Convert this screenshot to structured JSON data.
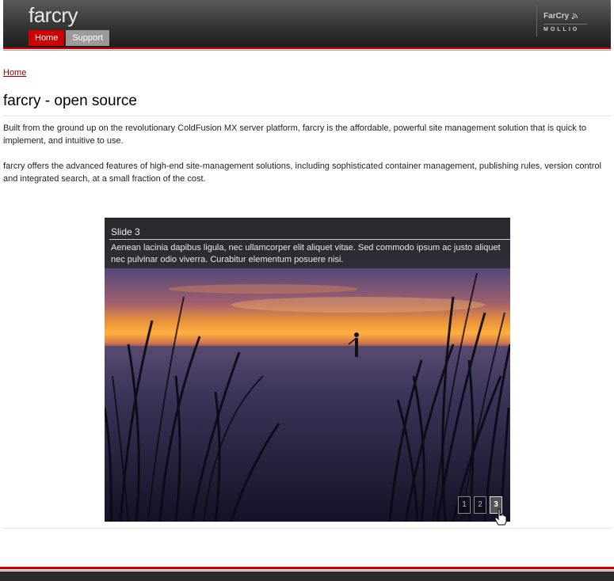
{
  "header": {
    "site_title": "farcry",
    "nav": [
      {
        "label": "Home",
        "active": true
      },
      {
        "label": "Support",
        "active": false
      }
    ],
    "brand_top": "FarCry",
    "brand_bottom": "MOLLIO"
  },
  "breadcrumb": {
    "home": "Home"
  },
  "page": {
    "title": "farcry - open source",
    "para1": "Built from the ground up on the revolutionary ColdFusion MX server platform, farcry is the affordable, powerful site management solution that is quick to implement, and intuitive to use.",
    "para2": "farcry offers the advanced features of high-end site-management solutions, including sophisticated container management, publishing rules, version control and integrated search, at a small fraction of the cost."
  },
  "slideshow": {
    "slide_title": "Slide 3",
    "caption": "Aenean lacinia dapibus ligula, nec ullamcorper elit aliquet vitae. Sed commodo ipsum ac justo aliquet nec pulvinar odio viverra. Curabitur elementum posuere nisi.",
    "pager": [
      "1",
      "2",
      "3"
    ],
    "current": "3"
  },
  "colors": {
    "accent": "#cc0000",
    "header_dark": "#1c1c1c",
    "link": "#990000"
  }
}
